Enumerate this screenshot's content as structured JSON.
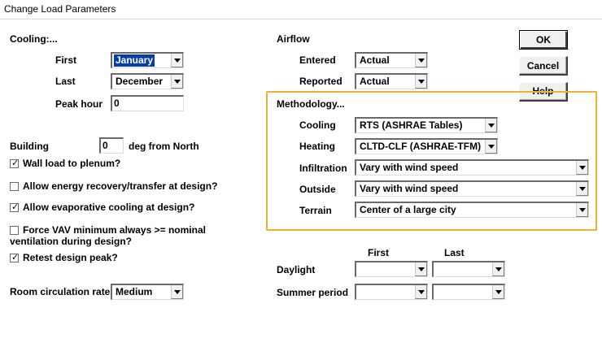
{
  "window": {
    "title": "Change Load Parameters"
  },
  "cooling": {
    "heading": "Cooling:...",
    "first_label": "First",
    "first_value": "January",
    "last_label": "Last",
    "last_value": "December",
    "peak_label": "Peak hour",
    "peak_value": "0"
  },
  "building": {
    "label": "Building",
    "value": "0",
    "unit": "deg from North"
  },
  "options": [
    {
      "label": "Wall load to plenum?",
      "checked": true
    },
    {
      "label": "Allow energy recovery/transfer at design?",
      "checked": false
    },
    {
      "label": "Allow evaporative cooling at design?",
      "checked": true
    },
    {
      "label": "Force VAV minimum always >= nominal",
      "label2": "ventilation during design?",
      "checked": false
    },
    {
      "label": "Retest design peak?",
      "checked": true
    }
  ],
  "room": {
    "label": "Room circulation rate",
    "value": "Medium"
  },
  "airflow": {
    "heading": "Airflow",
    "entered_label": "Entered",
    "entered_value": "Actual",
    "reported_label": "Reported",
    "reported_value": "Actual"
  },
  "methodology": {
    "heading": "Methodology...",
    "cooling_label": "Cooling",
    "cooling_value": "RTS (ASHRAE Tables)",
    "heating_label": "Heating",
    "heating_value": "CLTD-CLF (ASHRAE-TFM)",
    "infiltration_label": "Infiltration",
    "infiltration_value": "Vary with wind speed",
    "outside_label": "Outside",
    "outside_value": "Vary with wind speed",
    "terrain_label": "Terrain",
    "terrain_value": "Center of a large city"
  },
  "periods": {
    "first_header": "First",
    "last_header": "Last",
    "daylight_label": "Daylight",
    "summer_label": "Summer period"
  },
  "buttons": {
    "ok": "OK",
    "cancel": "Cancel",
    "help": "Help"
  },
  "colors": {
    "highlight": "#f0b030",
    "selection": "#0a3ca8"
  }
}
